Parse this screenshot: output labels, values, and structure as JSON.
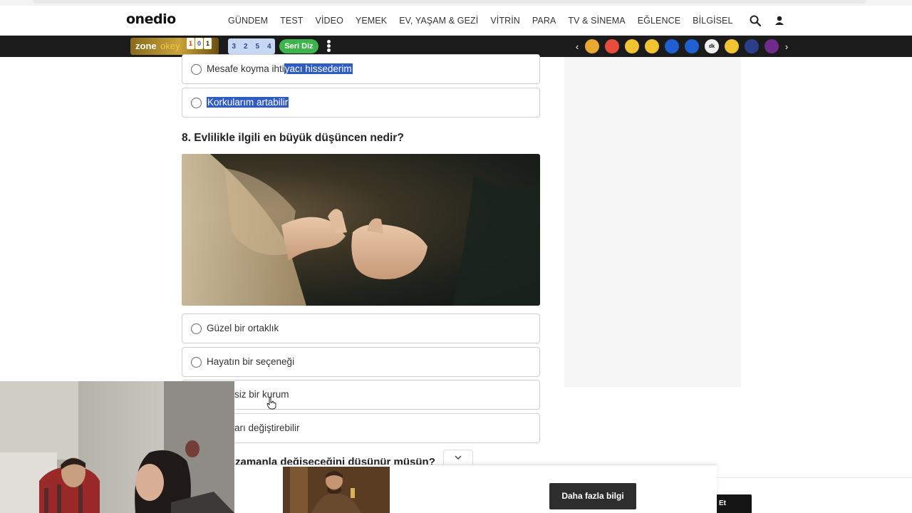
{
  "header": {
    "logo": "onedio",
    "nav": [
      "GÜNDEM",
      "TEST",
      "VİDEO",
      "YEMEK",
      "EV, YAŞAM & GEZİ",
      "VİTRİN",
      "PARA",
      "TV & SİNEMA",
      "EĞLENCE",
      "BİLGİSEL"
    ]
  },
  "gamebar": {
    "zone_text": "zone",
    "okey_text": "okey",
    "tiles": [
      "1",
      "0",
      "1"
    ],
    "numbers": [
      "3",
      "2",
      "5",
      "4"
    ],
    "seri_label": "Seri Diz",
    "emoji_colors": [
      "#e8a92e",
      "#e84c3d",
      "#f1c232",
      "#f1c232",
      "#1f5fd1",
      "#1f5fd1",
      "#f0f0f0",
      "#f1c232",
      "#2a3f88",
      "#6f2b8b"
    ],
    "emoji_icons": [
      "face-icon",
      "heart-eyes-icon",
      "sad-icon",
      "laugh-icon",
      "badge-icon",
      "badge-icon",
      "dk-icon",
      "smile-icon",
      "snowflake-icon",
      "bomb-icon"
    ],
    "emoji_text": [
      "",
      "",
      "",
      "",
      "",
      "",
      "dk",
      "",
      "",
      ""
    ]
  },
  "quiz": {
    "prev_options": [
      {
        "before": "Mesafe koyma ihti",
        "highlight": "yacı hissederim"
      },
      {
        "before": "",
        "highlight": "Korkularım artabilir"
      }
    ],
    "question": "8. Evlilikle ilgili en büyük düşüncen nedir?",
    "options": [
      "Güzel bir ortaklık",
      "Hayatın bir seçeneği",
      "siz bir kurum",
      "arı değiştirebilir"
    ],
    "next_question_partial": "zamanla değişeceğini düşünür müsün?"
  },
  "ad": {
    "more_info": "Daha fazla bilgi",
    "cta_partial": "Et"
  }
}
